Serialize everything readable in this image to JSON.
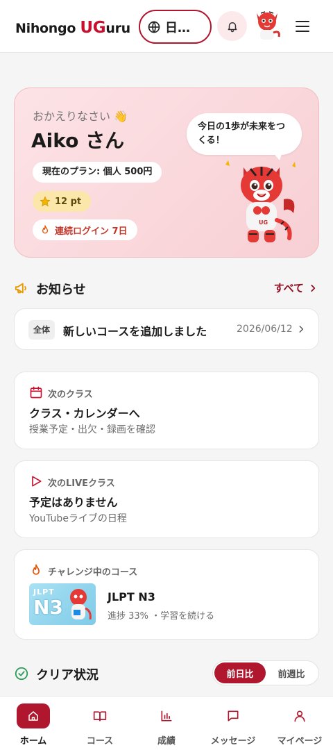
{
  "header": {
    "logo_prefix": "Nihongo ",
    "logo_brand": "UG",
    "logo_suffix": "uru",
    "language_label": "日…",
    "icons": {
      "language": "globe-icon",
      "notifications": "bell-icon",
      "menu": "hamburger-icon"
    }
  },
  "welcome": {
    "greeting": "おかえりなさい 👋",
    "user_name": "Aiko さん",
    "plan": "現在のプラン: 個人 500円",
    "points": "12 pt",
    "streak": "連続ログイン 7日",
    "speech": "今日の1歩が未来をつくる！"
  },
  "news": {
    "title": "お知らせ",
    "see_all": "すべて",
    "item": {
      "tag": "全体",
      "title": "新しいコースを追加しました",
      "date": "2026/06/12"
    }
  },
  "next_class": {
    "label": "次のクラス",
    "title": "クラス・カレンダーへ",
    "subtitle": "授業予定・出欠・録画を確認"
  },
  "next_live": {
    "label": "次のLIVEクラス",
    "title": "予定はありません",
    "subtitle": "YouTubeライブの日程"
  },
  "challenge": {
    "label": "チャレンジ中のコース",
    "thumb_line1": "JLPT",
    "thumb_line2": "N3",
    "course_title": "JLPT N3",
    "course_sub": "進捗 33% ・学習を続ける",
    "progress_percent": 33
  },
  "clear_status": {
    "title": "クリア状況",
    "tabs": [
      "前日比",
      "前週比"
    ],
    "active_tab": 0
  },
  "nav": {
    "items": [
      {
        "label": "ホーム",
        "icon": "home-icon"
      },
      {
        "label": "コース",
        "icon": "book-icon"
      },
      {
        "label": "成績",
        "icon": "chart-icon"
      },
      {
        "label": "メッセージ",
        "icon": "message-icon"
      },
      {
        "label": "マイページ",
        "icon": "user-icon"
      }
    ],
    "active": 0
  },
  "colors": {
    "brand": "#b0162e",
    "accent_red": "#c8102e",
    "card_pink": "#fde3e6",
    "points_yellow": "#fbe7a9"
  }
}
